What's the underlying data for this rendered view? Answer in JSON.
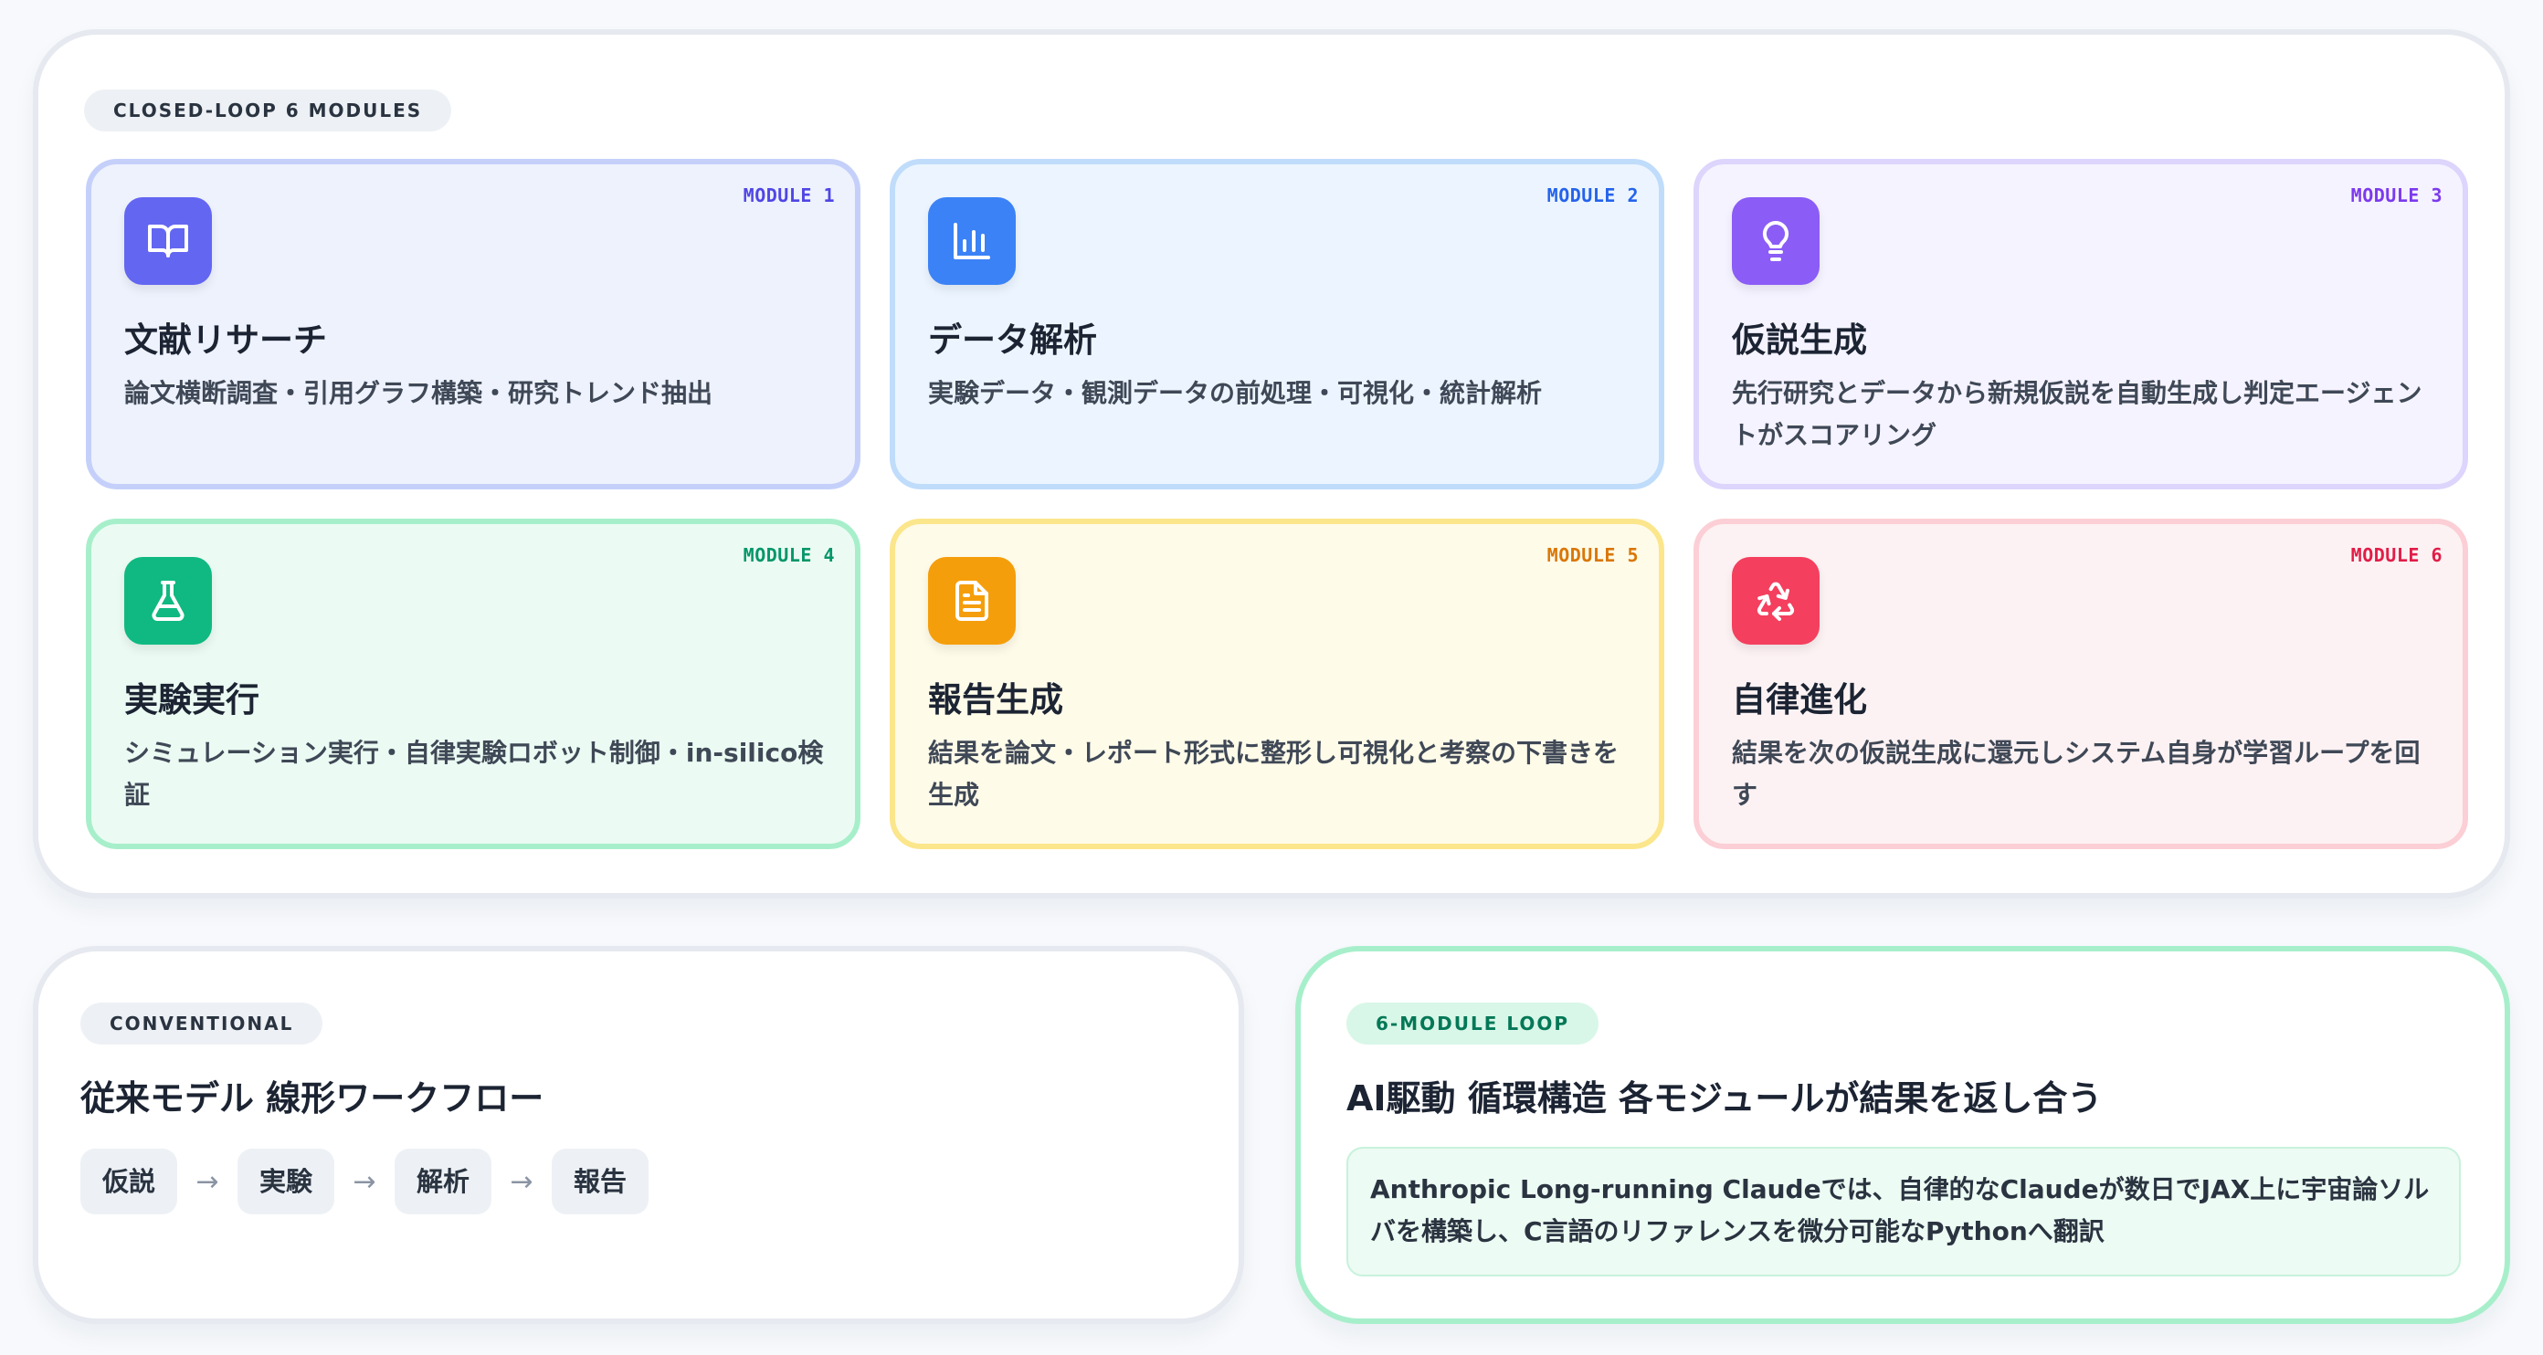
{
  "top_panel": {
    "chip": "CLOSED-LOOP 6 MODULES",
    "modules": [
      {
        "tag": "MODULE 1",
        "icon": "book-open-icon",
        "title": "文献リサーチ",
        "desc": "論文横断調査・引用グラフ構築・研究トレンド抽出",
        "color": "#6366f1"
      },
      {
        "tag": "MODULE 2",
        "icon": "bar-chart-icon",
        "title": "データ解析",
        "desc": "実験データ・観測データの前処理・可視化・統計解析",
        "color": "#3b82f6"
      },
      {
        "tag": "MODULE 3",
        "icon": "lightbulb-icon",
        "title": "仮説生成",
        "desc": "先行研究とデータから新規仮説を自動生成し判定エージェントがスコアリング",
        "color": "#8b5cf6"
      },
      {
        "tag": "MODULE 4",
        "icon": "flask-icon",
        "title": "実験実行",
        "desc": "シミュレーション実行・自律実験ロボット制御・in-silico検証",
        "color": "#10b981"
      },
      {
        "tag": "MODULE 5",
        "icon": "document-icon",
        "title": "報告生成",
        "desc": "結果を論文・レポート形式に整形し可視化と考察の下書きを生成",
        "color": "#f59e0b"
      },
      {
        "tag": "MODULE 6",
        "icon": "recycle-icon",
        "title": "自律進化",
        "desc": "結果を次の仮説生成に還元しシステム自身が学習ループを回す",
        "color": "#f43f5e"
      }
    ]
  },
  "conventional": {
    "chip": "CONVENTIONAL",
    "title": "従来モデル 線形ワークフロー",
    "steps": [
      "仮説",
      "実験",
      "解析",
      "報告"
    ],
    "arrow": "→"
  },
  "loop": {
    "chip": "6-MODULE LOOP",
    "title": "AI駆動 循環構造 各モジュールが結果を返し合う",
    "note": "Anthropic Long-running Claudeでは、自律的なClaudeが数日でJAX上に宇宙論ソルバを構築し、C言語のリファレンスを微分可能なPythonへ翻訳"
  }
}
